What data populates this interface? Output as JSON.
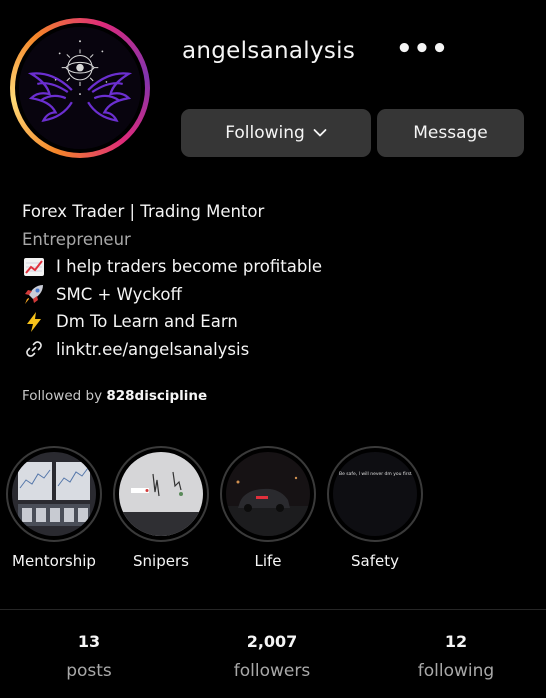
{
  "profile": {
    "username": "angelsanalysis",
    "more_glyph": "•••"
  },
  "buttons": {
    "following_label": "Following",
    "message_label": "Message"
  },
  "bio": {
    "line1": "Forex Trader | Trading Mentor",
    "line2": "Entrepreneur",
    "line3": "I help traders become profitable",
    "line4": "SMC + Wyckoff",
    "line5": "Dm To Learn and Earn",
    "link": "linktr.ee/angelsanalysis"
  },
  "followed_by": {
    "prefix": "Followed by",
    "user": "828discipline"
  },
  "highlights": [
    {
      "label": "Mentorship"
    },
    {
      "label": "Snipers"
    },
    {
      "label": "Life"
    },
    {
      "label": "Safety",
      "caption": "Be safe, I will never dm you first ⚠"
    }
  ],
  "stats": {
    "posts": {
      "value": "13",
      "label": "posts"
    },
    "followers": {
      "value": "2,007",
      "label": "followers"
    },
    "following": {
      "value": "12",
      "label": "following"
    }
  },
  "colors": {
    "background": "#000000",
    "button": "#363636",
    "muted_text": "#a8a8a8",
    "avatar_wings": "#6b2fd0"
  },
  "icons": {
    "bio_line3": "chart-increasing-icon",
    "bio_line4": "rocket-icon",
    "bio_line5": "lightning-icon",
    "link": "link-icon"
  }
}
